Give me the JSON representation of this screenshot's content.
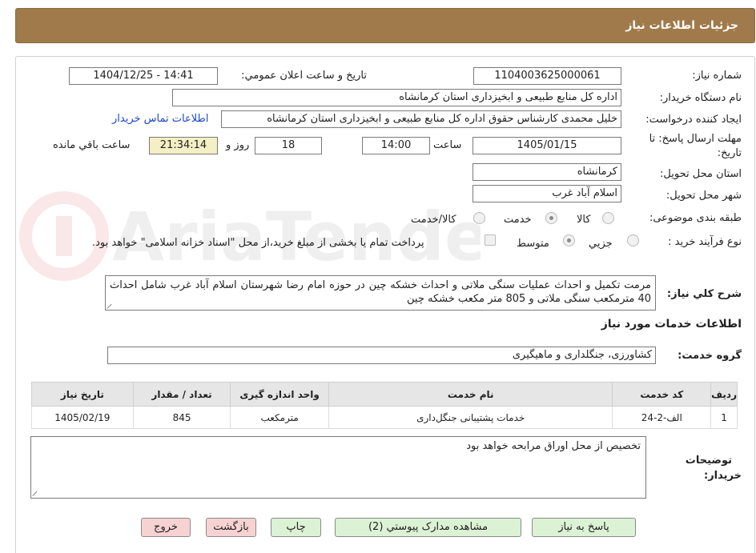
{
  "header": {
    "title": "جزئیات اطلاعات نیاز"
  },
  "form": {
    "need_number_label": "شماره نیاز:",
    "need_number": "1104003625000061",
    "announce_label": "تاریخ و ساعت اعلان عمومي:",
    "announce_value": "1404/12/25 - 14:41",
    "buyer_org_label": "نام دستگاه خریدار:",
    "buyer_org": "اداره کل منابع طبیعی و ابخیزداری استان کرمانشاه",
    "creator_label": "ایجاد کننده درخواست:",
    "creator": "خلیل محمدی کارشناس حقوق اداره کل منابع طبیعی و ابخیزداری استان کرمانشاه",
    "contact_link": "اطلاعات تماس خریدار",
    "deadline_label_line1": "مهلت ارسال پاسخ: تا",
    "deadline_label_line2": "تاریخ:",
    "deadline_date": "1405/01/15",
    "time_label": "ساعت",
    "deadline_time": "14:00",
    "days_value": "18",
    "days_label": "روز و",
    "remaining_time": "21:34:14",
    "remaining_label": "ساعت باقي مانده",
    "province_label": "استان محل تحویل:",
    "province": "کرمانشاه",
    "city_label": "شهر محل تحویل:",
    "city": "اسلام آباد غرب",
    "category_label": "طبقه بندی موضوعی:",
    "category_options": [
      "کالا",
      "خدمت",
      "کالا/خدمت"
    ],
    "process_label": "نوع فرآیند خرید :",
    "process_options": [
      "جزیي",
      "متوسط"
    ],
    "payment_note": "پرداخت تمام یا بخشی از مبلغ خرید،از محل \"اسناد خزانه اسلامی\" خواهد بود."
  },
  "description": {
    "label": "شرح کلي نیاز:",
    "text": "مرمت تکمیل و احداث عملیات سنگی ملاتی و احداث خشکه چین در حوزه امام رضا شهرستان اسلام آباد غرب شامل احداث 40 مترمکعب سنگی ملاتی و 805 متر مکعب خشکه چین"
  },
  "services": {
    "section_title": "اطلاعات خدمات مورد نیاز",
    "group_label": "گروه خدمت:",
    "group_value": "کشاورزی، جنگلداری و ماهیگیری",
    "columns": [
      "ردیف",
      "کد خدمت",
      "نام خدمت",
      "واحد اندازه گیری",
      "تعداد / مقدار",
      "تاریخ نیاز"
    ],
    "rows": [
      [
        "1",
        "الف-2-24",
        "خدمات پشتیبانی جنگل‌داری",
        "مترمکعب",
        "845",
        "1405/02/19"
      ]
    ]
  },
  "buyer_notes": {
    "label_line1": "توضیحات",
    "label_line2": "خریدار:",
    "text": "تخصیص از محل اوراق مرابحه خواهد بود"
  },
  "buttons": {
    "reply": "پاسخ به نیاز",
    "view_docs": "مشاهده مدارک پیوستي (2)",
    "print": "چاپ",
    "back": "بازگشت",
    "exit": "خروج"
  },
  "watermark": {
    "text": "AriaTender.neT"
  },
  "colors": {
    "header_bg": "#a07a4a",
    "link": "#1b47c9",
    "remaining_bg": "#f4efc4",
    "button_green": "#dcf2d4",
    "button_pink": "#f7d2d2"
  }
}
